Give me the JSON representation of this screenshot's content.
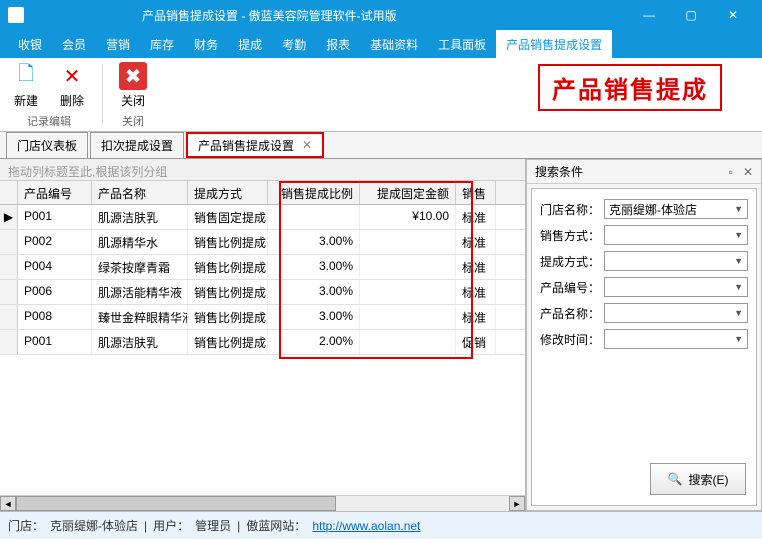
{
  "title": "产品销售提成设置 - 傲蓝美容院管理软件-试用版",
  "menu": [
    "收银",
    "会员",
    "营销",
    "库存",
    "财务",
    "提成",
    "考勤",
    "报表",
    "基础资料",
    "工具面板",
    "产品销售提成设置"
  ],
  "menu_active_index": 10,
  "ribbon": {
    "banner": "产品销售提成",
    "group1": {
      "label": "记录编辑",
      "buttons": [
        {
          "label": "新建",
          "icon": "🗋",
          "color": "#1296db"
        },
        {
          "label": "删除",
          "icon": "✕",
          "color": "#d00"
        }
      ]
    },
    "group2": {
      "label": "关闭",
      "buttons": [
        {
          "label": "关闭",
          "icon": "✖",
          "color": "#fff",
          "bg": "#d33"
        }
      ]
    }
  },
  "doctabs": [
    {
      "label": "门店仪表板",
      "active": false
    },
    {
      "label": "扣次提成设置",
      "active": false
    },
    {
      "label": "产品销售提成设置",
      "active": true,
      "closable": true,
      "highlight": true
    }
  ],
  "group_hint": "拖动列标题至此,根据该列分组",
  "columns": [
    "产品编号",
    "产品名称",
    "提成方式",
    "销售提成比例",
    "提成固定金额",
    "销售方"
  ],
  "rows": [
    {
      "c": [
        "P001",
        "肌源洁肤乳",
        "销售固定提成",
        "",
        "¥10.00",
        "标准"
      ],
      "sel": true
    },
    {
      "c": [
        "P002",
        "肌源精华水",
        "销售比例提成",
        "3.00%",
        "",
        "标准"
      ]
    },
    {
      "c": [
        "P004",
        "绿茶按摩青霜",
        "销售比例提成",
        "3.00%",
        "",
        "标准"
      ]
    },
    {
      "c": [
        "P006",
        "肌源活能精华液",
        "销售比例提成",
        "3.00%",
        "",
        "标准"
      ]
    },
    {
      "c": [
        "P008",
        "臻世金粹眼精华液",
        "销售比例提成",
        "3.00%",
        "",
        "标准"
      ]
    },
    {
      "c": [
        "P001",
        "肌源洁肤乳",
        "销售比例提成",
        "2.00%",
        "",
        "促销"
      ]
    }
  ],
  "search": {
    "title": "搜索条件",
    "fields": [
      {
        "label": "门店名称：",
        "value": "克丽缇娜-体验店"
      },
      {
        "label": "销售方式：",
        "value": ""
      },
      {
        "label": "提成方式：",
        "value": ""
      },
      {
        "label": "产品编号：",
        "value": ""
      },
      {
        "label": "产品名称：",
        "value": ""
      },
      {
        "label": "修改时间：",
        "value": ""
      }
    ],
    "button": "搜索(E)"
  },
  "status": {
    "store_label": "门店：",
    "store": "克丽缇娜-体验店",
    "user_label": "用户：",
    "user": "管理员",
    "site_label": "傲蓝网站：",
    "site": "http://www.aolan.net"
  }
}
